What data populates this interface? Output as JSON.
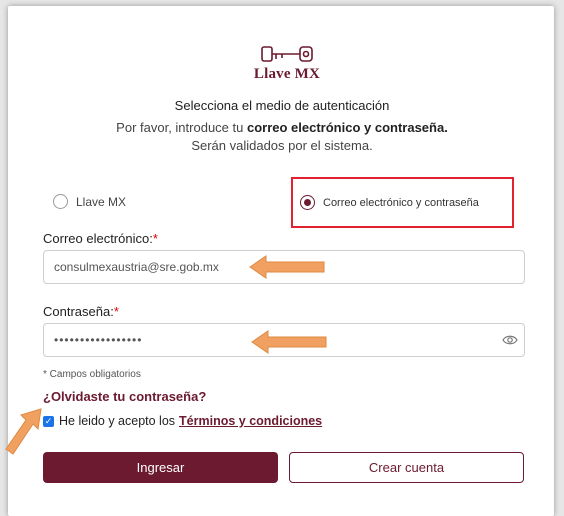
{
  "brand": {
    "name": "Llave MX",
    "accent_color": "#6b1a2f"
  },
  "header": {
    "title": "Selecciona el medio de autenticación",
    "subtitle_prefix": "Por favor, introduce tu ",
    "subtitle_bold": "correo electrónico y contraseña.",
    "subtitle2": "Serán validados por el sistema."
  },
  "auth_methods": {
    "options": [
      {
        "label": "Llave MX",
        "selected": false
      },
      {
        "label": "Correo electrónico y contraseña",
        "selected": true
      }
    ],
    "highlight_color": "#e2222e"
  },
  "form": {
    "email_label": "Correo electrónico:",
    "email_value": "consulmexaustria@sre.gob.mx",
    "password_label": "Contraseña:",
    "password_value": "•••••••••••••••••",
    "required_marker": "*",
    "required_note": "* Campos obligatorios",
    "forgot_password": "¿Olvidaste tu contraseña?",
    "terms_prefix": "He leido y acepto los",
    "terms_link": "Términos y condiciones",
    "terms_checked": true
  },
  "actions": {
    "primary_label": "Ingresar",
    "secondary_label": "Crear cuenta"
  },
  "annotations": {
    "arrow_color": "#f0a060",
    "icons": [
      "arrow-left-icon",
      "arrow-left-icon",
      "arrow-diagonal-icon",
      "eye-icon"
    ]
  }
}
